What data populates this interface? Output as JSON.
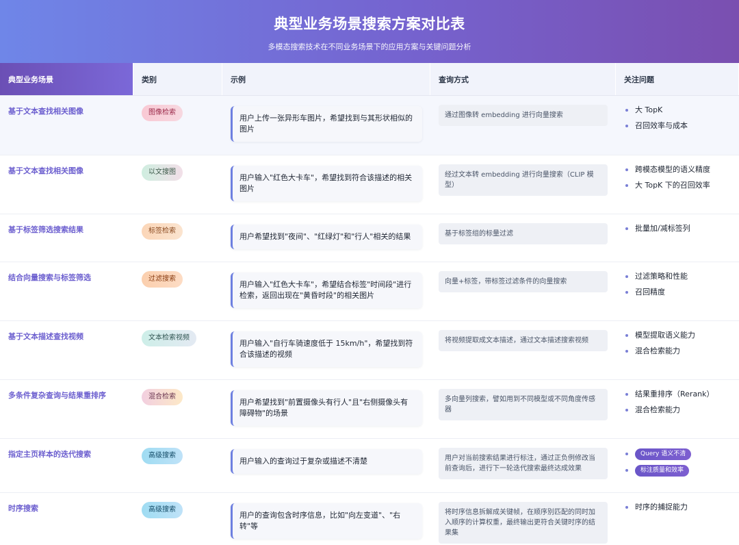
{
  "header": {
    "title": "典型业务场景搜索方案对比表",
    "subtitle": "多模态搜索技术在不同业务场景下的应用方案与关键问题分析"
  },
  "columns": [
    "典型业务场景",
    "类别",
    "示例",
    "查询方式",
    "关注问题"
  ],
  "rows": [
    {
      "scene": "基于文本查找相关图像",
      "category": "图像检索",
      "example": "用户上传一张异形车图片，希望找到与其形状相似的图片",
      "query": "通过图像转 embedding 进行向量搜索",
      "focus": [
        "大 TopK",
        "召回效率与成本"
      ]
    },
    {
      "scene": "基于文本查找相关图像",
      "category": "以文搜图",
      "example": "用户输入\"红色大卡车\"，希望找到符合该描述的相关图片",
      "query": "经过文本转 embedding 进行向量搜索（CLIP 模型）",
      "focus": [
        "跨模态模型的语义精度",
        "大 TopK 下的召回效率"
      ]
    },
    {
      "scene": "基于标签筛选搜索结果",
      "category": "标签检索",
      "example": "用户希望找到\"夜间\"、\"红绿灯\"和\"行人\"相关的结果",
      "query": "基于标签组的标量过滤",
      "focus": [
        "批量加/减标签列"
      ]
    },
    {
      "scene": "结合向量搜索与标签筛选",
      "category": "过滤搜索",
      "example": "用户输入\"红色大卡车\"，希望结合标签\"时间段\"进行检索，返回出现在\"黄昏时段\"的相关图片",
      "query": "向量+标签，带标签过滤条件的向量搜索",
      "focus": [
        "过滤策略和性能",
        "召回精度"
      ]
    },
    {
      "scene": "基于文本描述查找视频",
      "category": "文本检索视频",
      "example": "用户输入\"自行车骑速度低于 15km/h\"，希望找到符合该描述的视频",
      "query": "将视频提取成文本描述，通过文本描述搜索视频",
      "focus": [
        "模型提取语义能力",
        "混合检索能力"
      ]
    },
    {
      "scene": "多条件复杂查询与结果重排序",
      "category": "混合检索",
      "example": "用户希望找到\"前置摄像头有行人\"且\"右侧摄像头有障碍物\"的场景",
      "query": "多向量列搜索，譬如用到不同模型或不同角度传感器",
      "focus": [
        "结果重排序（Rerank）",
        "混合检索能力"
      ]
    },
    {
      "scene": "指定主页样本的迭代搜索",
      "category": "高级搜索",
      "example": "用户输入的查询过于复杂或描述不清楚",
      "query": "用户对当前搜索结果进行标注，通过正负例修改当前查询后，进行下一轮迭代搜索最终达成效果",
      "focus": [
        "Query 语义不清",
        "标注质量和效率"
      ]
    },
    {
      "scene": "时序搜索",
      "category": "高级搜索",
      "example": "用户的查询包含时序信息，比如\"向左变道\"、\"右转\"等",
      "query": "将时序信息拆解成关键帧，在顺序别匹配的同时加入顺序的计算权重，最终输出更符合关键时序的结果集",
      "focus": [
        "时序的捕捉能力"
      ]
    }
  ]
}
